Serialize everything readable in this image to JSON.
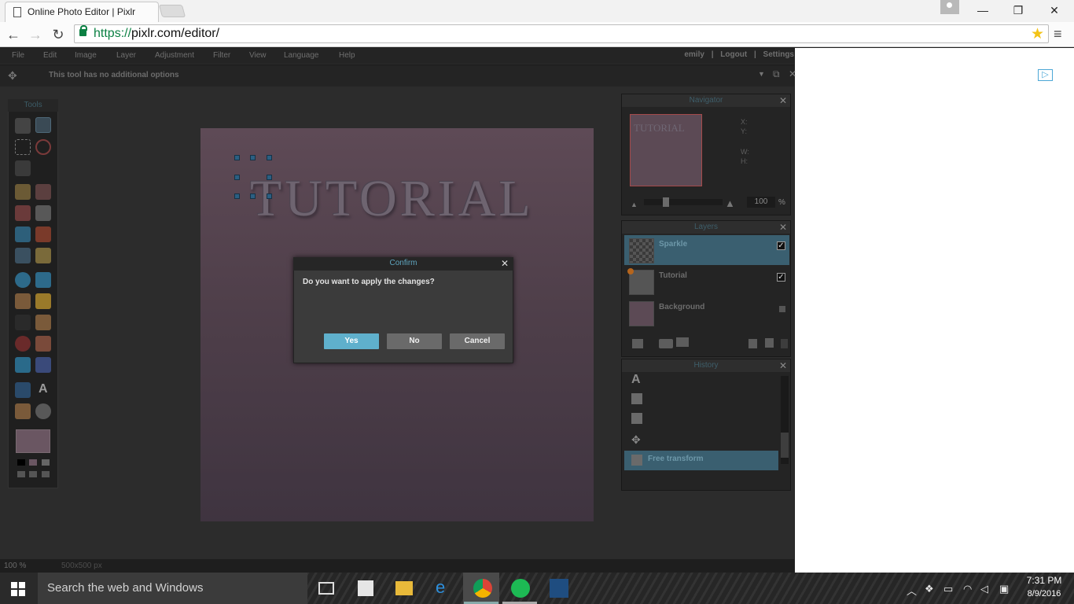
{
  "browser": {
    "tab_title": "Online Photo Editor | Pixlr",
    "url_https": "https://",
    "url_rest": "pixlr.com/editor/",
    "window_controls": {
      "minimize": "—",
      "restore": "❐",
      "close": "✕"
    }
  },
  "menubar": {
    "items": [
      "File",
      "Edit",
      "Image",
      "Layer",
      "Adjustment",
      "Filter",
      "View",
      "Language",
      "Help"
    ],
    "user": "emily",
    "logout": "Logout",
    "settings": "Settings"
  },
  "options_bar": {
    "message": "This tool has no additional options"
  },
  "tools_panel": {
    "title": "Tools"
  },
  "canvas": {
    "text": "TUTORIAL"
  },
  "status": {
    "zoom": "100",
    "zoom_unit": "%",
    "size": "500x500 px"
  },
  "navigator": {
    "title": "Navigator",
    "thumb_text": "TUTORIAL",
    "x_label": "X:",
    "y_label": "Y:",
    "w_label": "W:",
    "h_label": "H:",
    "zoom_value": "100",
    "zoom_unit": "%"
  },
  "layers": {
    "title": "Layers",
    "items": [
      {
        "name": "Sparkle",
        "visible": true,
        "selected": true
      },
      {
        "name": "Tutorial",
        "visible": true,
        "selected": false
      },
      {
        "name": "Background",
        "locked": true,
        "selected": false
      }
    ]
  },
  "history": {
    "title": "History",
    "items": [
      "Free transform"
    ]
  },
  "dialog": {
    "title": "Confirm",
    "message": "Do you want to apply the changes?",
    "yes": "Yes",
    "no": "No",
    "cancel": "Cancel"
  },
  "taskbar": {
    "search_placeholder": "Search the web and Windows",
    "time": "7:31 PM",
    "date": "8/9/2016"
  },
  "colors": {
    "accent": "#5fb0cc",
    "selected_layer": "#3a5f70",
    "canvas_bg": "#4f3f4a"
  }
}
